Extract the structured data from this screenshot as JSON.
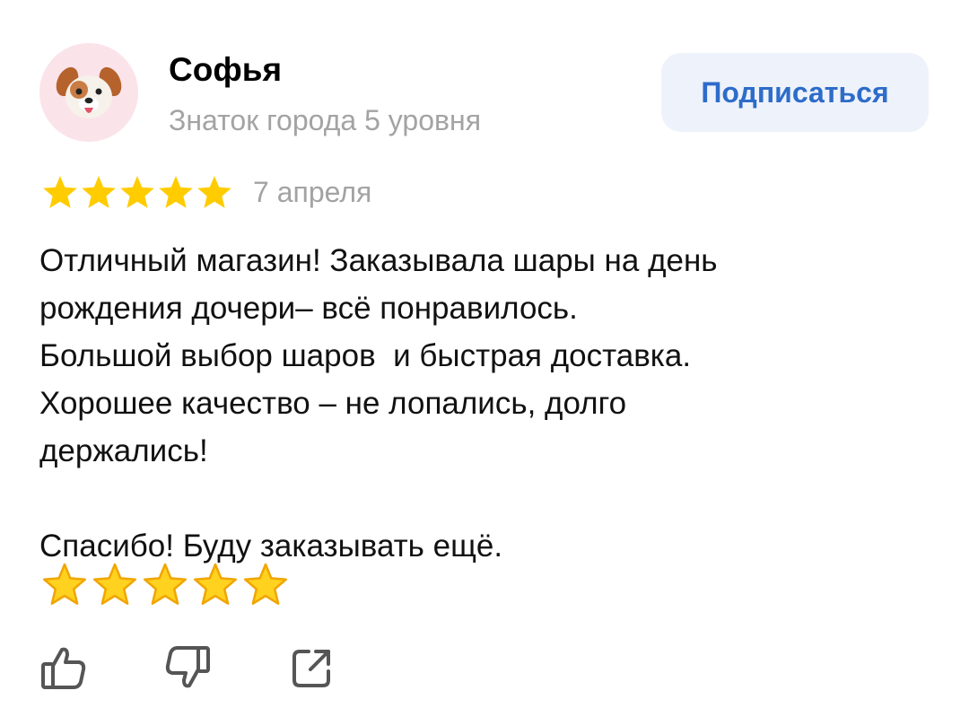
{
  "review": {
    "author": {
      "name": "Софья",
      "rank": "Знаток города 5 уровня",
      "avatar_icon": "dog-face-icon"
    },
    "subscribe_label": "Подписаться",
    "rating": 5,
    "date": "7 апреля",
    "text": "Отличный магазин! Заказывала шары на день\nрождения дочери– всё понравилось.\nБольшой выбор шаров  и быстрая доставка.\nХорошее качество – не лопались, долго\nдержались!\n\nСпасибо! Буду заказывать ещё.",
    "emoji_stars": 5
  },
  "actions": [
    {
      "name": "like",
      "icon": "thumbs-up-icon"
    },
    {
      "name": "dislike",
      "icon": "thumbs-down-icon"
    },
    {
      "name": "share",
      "icon": "share-icon"
    }
  ],
  "colors": {
    "star": "#ffcc00",
    "accent": "#2d6cc9",
    "button_bg": "#eef2fb",
    "secondary_text": "#a3a3a3",
    "avatar_bg": "#fbe3ea"
  }
}
